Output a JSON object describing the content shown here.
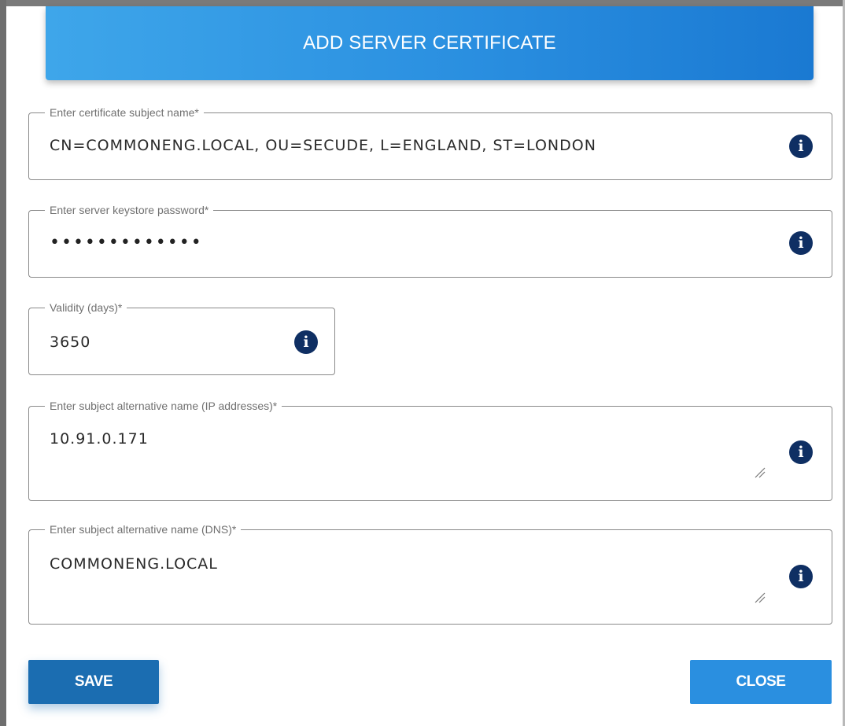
{
  "dialog": {
    "title": "ADD SERVER CERTIFICATE"
  },
  "fields": {
    "subject_name": {
      "label": "Enter certificate subject name*",
      "value": "CN=COMMONENG.LOCAL, OU=SECUDE, L=ENGLAND, ST=LONDON"
    },
    "keystore_password": {
      "label": "Enter server keystore password*",
      "value": "•••••••••••••"
    },
    "validity": {
      "label": "Validity (days)*",
      "value": "3650"
    },
    "san_ip": {
      "label": "Enter subject alternative name (IP addresses)*",
      "value": "10.91.0.171"
    },
    "san_dns": {
      "label": "Enter subject alternative name (DNS)*",
      "value": "COMMONENG.LOCAL"
    }
  },
  "icons": {
    "info": "info-icon",
    "info_glyph": "i"
  },
  "buttons": {
    "save": "SAVE",
    "close": "CLOSE"
  },
  "colors": {
    "header_gradient_start": "#3ea6ea",
    "header_gradient_end": "#1a79d2",
    "info_icon": "#0f2f63",
    "save_button": "#1b6db1",
    "close_button": "#2a8fe0"
  }
}
